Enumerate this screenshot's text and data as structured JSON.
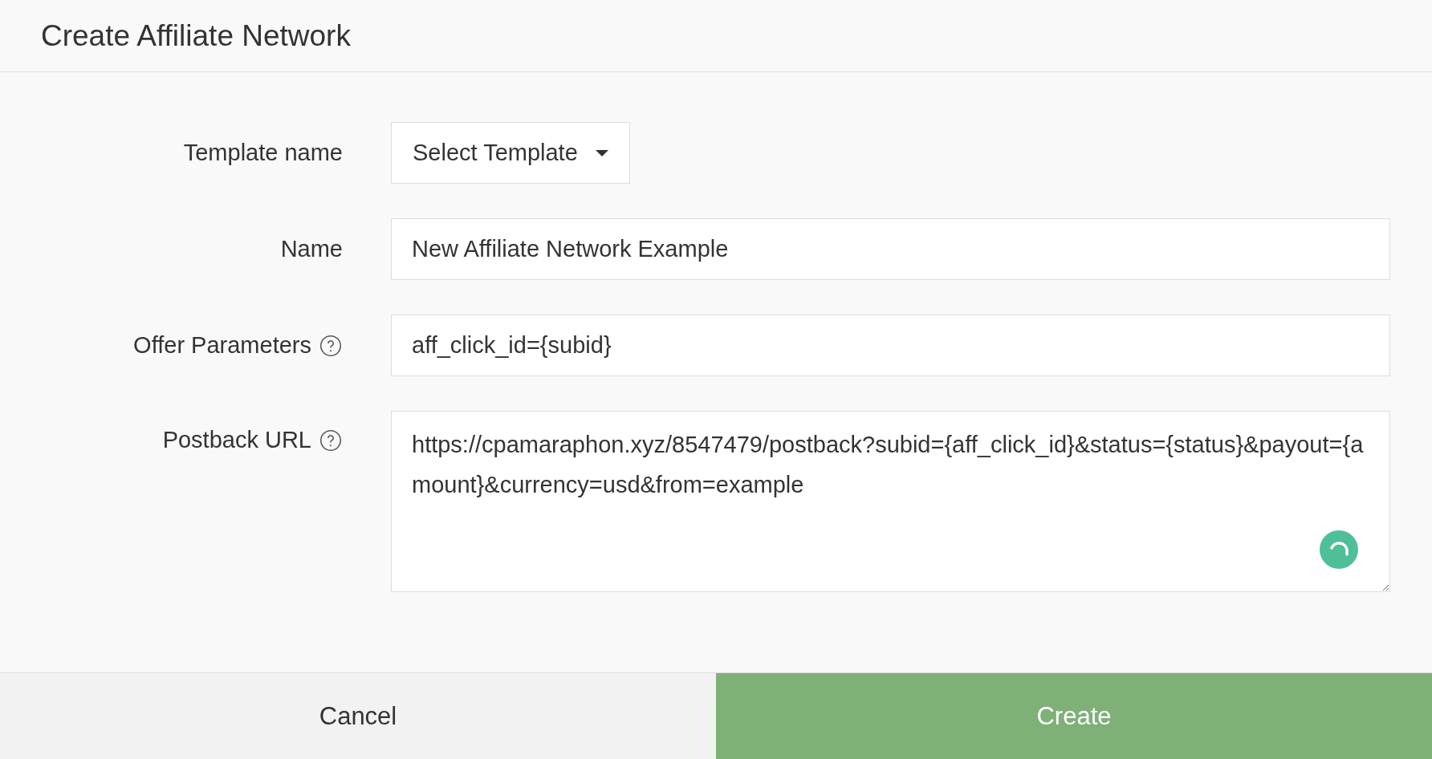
{
  "dialog": {
    "title": "Create Affiliate Network"
  },
  "form": {
    "template": {
      "label": "Template name",
      "value": "Select Template"
    },
    "name": {
      "label": "Name",
      "value": "New Affiliate Network Example"
    },
    "offer_parameters": {
      "label": "Offer Parameters",
      "value": "aff_click_id={subid}"
    },
    "postback_url": {
      "label": "Postback URL",
      "value": "https://cpamaraphon.xyz/8547479/postback?subid={aff_click_id}&status={status}&payout={amount}&currency=usd&from=example"
    }
  },
  "buttons": [
    {
      "label": "Cancel",
      "kind": "secondary"
    },
    {
      "label": "Create",
      "kind": "primary"
    }
  ]
}
